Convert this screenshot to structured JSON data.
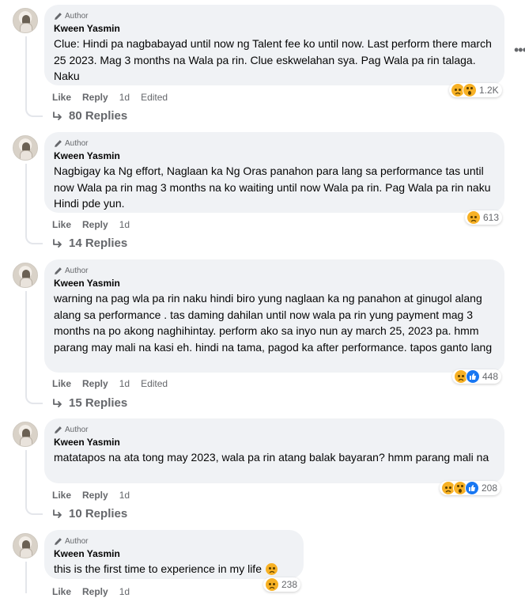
{
  "comments": [
    {
      "author_badge": "Author",
      "name": "Kween Yasmin",
      "text": "Clue: Hindi pa nagbabayad until now ng Talent fee ko until now. Last perform there march 25 2023. Mag 3 months na Wala pa rin. Clue eskwelahan sya. Pag Wala pa rin talaga. Naku",
      "reaction_icons": [
        "sad-icon",
        "wow-icon"
      ],
      "reaction_count": "1.2K",
      "like": "Like",
      "reply": "Reply",
      "time": "1d",
      "edited": "Edited",
      "replies": "80 Replies"
    },
    {
      "author_badge": "Author",
      "name": "Kween Yasmin",
      "text": "Nagbigay ka Ng effort, Naglaan ka Ng Oras panahon para lang sa performance tas until now Wala pa rin mag 3 months na ko waiting until now Wala pa rin. Pag Wala pa rin naku Hindi pde yun.",
      "reaction_icons": [
        "sad-icon"
      ],
      "reaction_count": "613",
      "like": "Like",
      "reply": "Reply",
      "time": "1d",
      "edited": "",
      "replies": "14 Replies"
    },
    {
      "author_badge": "Author",
      "name": "Kween Yasmin",
      "text": "warning na pag wla pa rin naku hindi biro yung naglaan ka ng panahon at ginugol alang alang sa performance . tas daming dahilan until now wala pa rin yung payment mag 3 months na po akong naghihintay. perform ako sa inyo nun ay march 25, 2023 pa. hmm parang may mali na kasi eh. hindi na tama, pagod ka after performance. tapos ganto lang",
      "reaction_icons": [
        "sad-icon",
        "like-icon"
      ],
      "reaction_count": "448",
      "like": "Like",
      "reply": "Reply",
      "time": "1d",
      "edited": "Edited",
      "replies": "15 Replies"
    },
    {
      "author_badge": "Author",
      "name": "Kween Yasmin",
      "text": "matatapos na ata tong may 2023, wala pa rin atang balak bayaran? hmm parang mali na",
      "reaction_icons": [
        "sad-icon",
        "wow-icon",
        "like-icon"
      ],
      "reaction_count": "208",
      "like": "Like",
      "reply": "Reply",
      "time": "1d",
      "edited": "",
      "replies": "10 Replies"
    },
    {
      "author_badge": "Author",
      "name": "Kween Yasmin",
      "text": "this is the first time to experience in my life",
      "emoji_inline": "sad-icon",
      "reaction_icons": [
        "sad-icon"
      ],
      "reaction_count": "238",
      "like": "Like",
      "reply": "Reply",
      "time": "1d",
      "edited": "",
      "replies": ""
    }
  ],
  "colors": {
    "bubble": "#f0f2f5",
    "meta_text": "#65676b",
    "sad": "#f7b125",
    "like": "#1877f2"
  }
}
